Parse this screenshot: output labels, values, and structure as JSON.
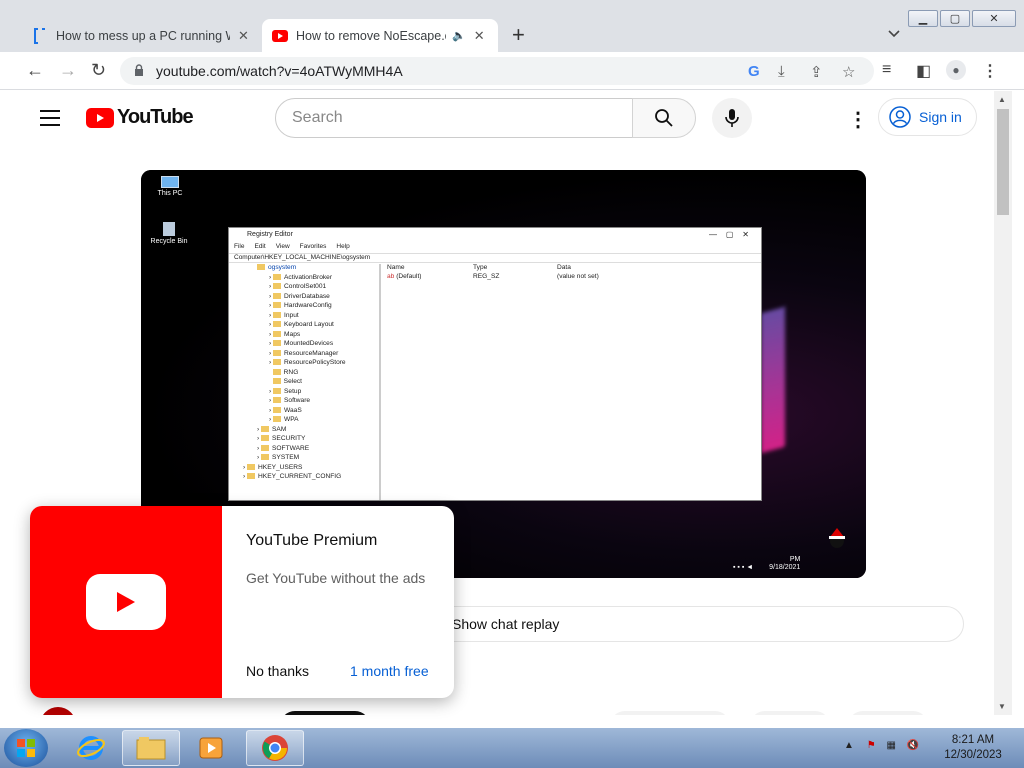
{
  "browser": {
    "tabs": [
      {
        "title": "How to mess up a PC running W",
        "favicon": "doc-bracket-icon",
        "active": false
      },
      {
        "title": "How to remove NoEscape.ex",
        "favicon": "youtube-icon",
        "active": true,
        "audio": true
      }
    ],
    "url": "youtube.com/watch?v=4oATWyMMH4A",
    "window_controls": [
      "minimize",
      "maximize",
      "close"
    ]
  },
  "youtube": {
    "logo_text": "YouTube",
    "search_placeholder": "Search",
    "sign_in_label": "Sign in",
    "chat_replay_label": "Show chat replay"
  },
  "video": {
    "desktop_icons": [
      "This PC",
      "Recycle Bin"
    ],
    "regedit": {
      "title": "Registry Editor",
      "menu": [
        "File",
        "Edit",
        "View",
        "Favorites",
        "Help"
      ],
      "address": "Computer\\HKEY_LOCAL_MACHINE\\ogsystem",
      "tree": [
        "ogsystem",
        "ActivationBroker",
        "ControlSet001",
        "DriverDatabase",
        "HardwareConfig",
        "Input",
        "Keyboard Layout",
        "Maps",
        "MountedDevices",
        "ResourceManager",
        "ResourcePolicyStore",
        "RNG",
        "Select",
        "Setup",
        "Software",
        "WaaS",
        "WPA",
        "SAM",
        "SECURITY",
        "SOFTWARE",
        "SYSTEM",
        "HKEY_USERS",
        "HKEY_CURRENT_CONFIG"
      ],
      "columns": [
        "Name",
        "Type",
        "Data"
      ],
      "row": {
        "name": "(Default)",
        "type": "REG_SZ",
        "data": "(value not set)"
      }
    },
    "tray_time": "PM",
    "tray_date": "9/18/2021"
  },
  "premium_popup": {
    "title": "YouTube Premium",
    "subtitle": "Get YouTube without the ads",
    "dismiss_label": "No thanks",
    "cta_label": "1 month free"
  },
  "taskbar": {
    "time": "8:21 AM",
    "date": "12/30/2023",
    "apps": [
      "internet-explorer-icon",
      "file-explorer-icon",
      "media-player-icon",
      "chrome-icon"
    ]
  }
}
